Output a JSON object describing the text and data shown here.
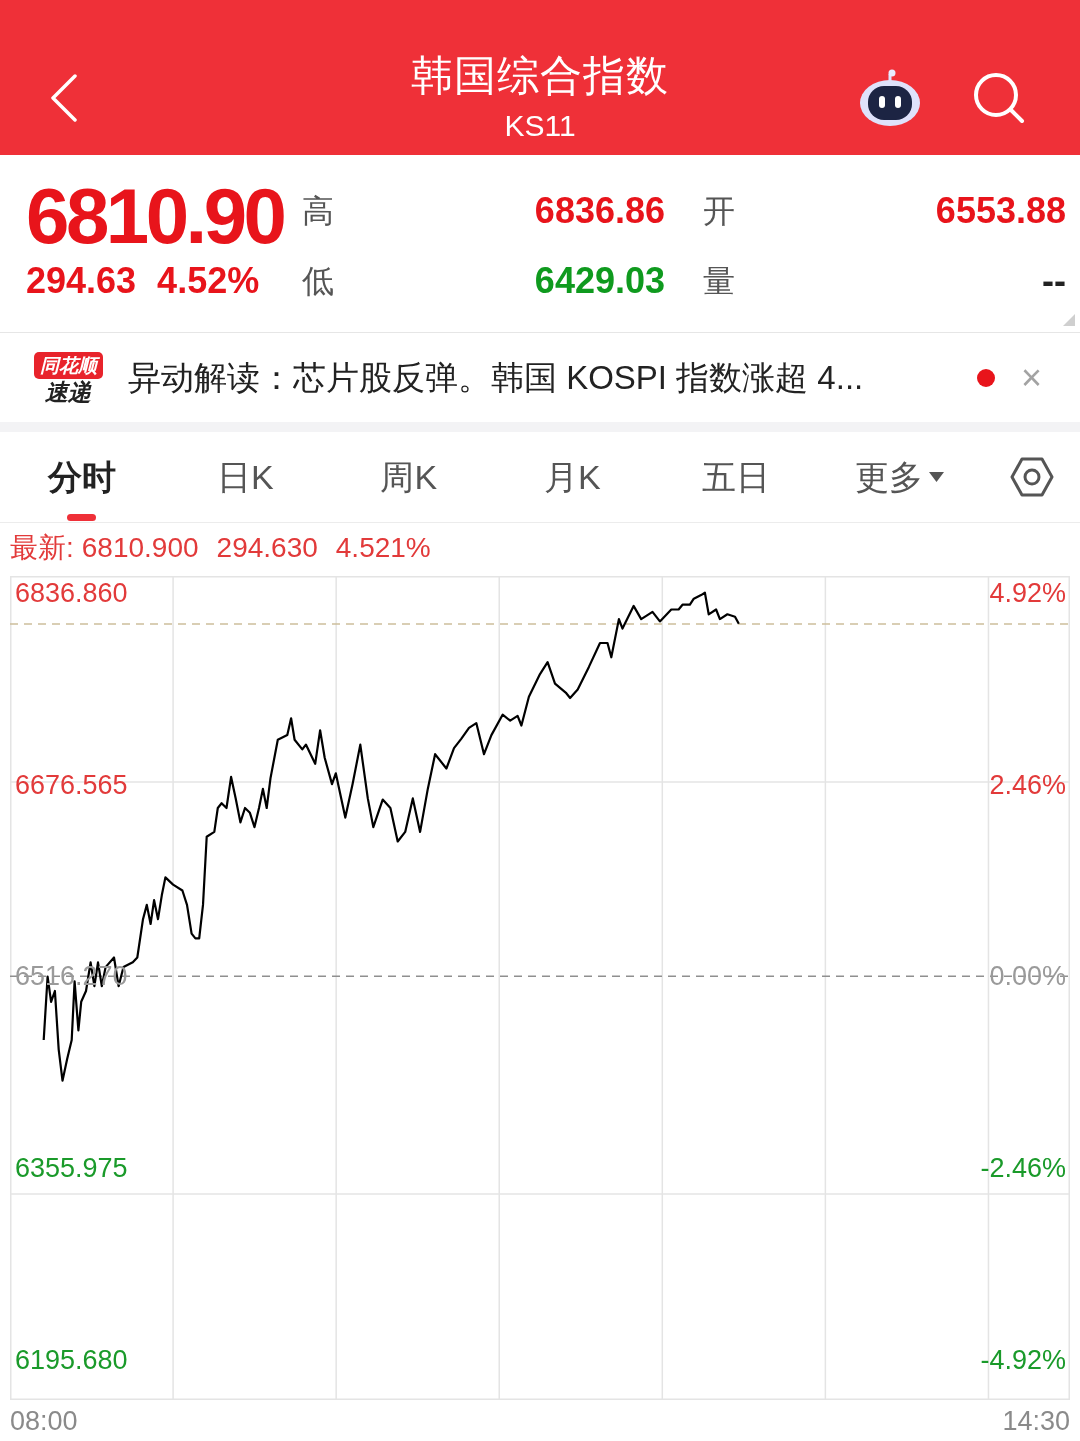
{
  "header": {
    "title": "韩国综合指数",
    "code": "KS11"
  },
  "quote": {
    "price": "6810.90",
    "change": "294.63",
    "change_pct": "4.52%",
    "rising": true,
    "stats": [
      {
        "label": "高",
        "value": "6836.86",
        "color": "#e8141b"
      },
      {
        "label": "开",
        "value": "6553.88",
        "color": "#e8141b"
      },
      {
        "label": "低",
        "value": "6429.03",
        "color": "#0f9a1e"
      },
      {
        "label": "量",
        "value": "--",
        "color": "#222222"
      }
    ]
  },
  "news": {
    "logo_top": "同花顺",
    "logo_bottom": "速递",
    "headline": "异动解读：芯片股反弹。韩国 KOSPI 指数涨超 4...",
    "unread": true,
    "close": "×"
  },
  "tabs": [
    {
      "label": "分时",
      "selected": true,
      "kind": "plain"
    },
    {
      "label": "日K",
      "selected": false,
      "kind": "plain"
    },
    {
      "label": "周K",
      "selected": false,
      "kind": "plain"
    },
    {
      "label": "月K",
      "selected": false,
      "kind": "plain"
    },
    {
      "label": "五日",
      "selected": false,
      "kind": "plain"
    },
    {
      "label": "更多",
      "selected": false,
      "kind": "dropdown"
    }
  ],
  "chart": {
    "latest": {
      "label": "最新:",
      "price": "6810.900",
      "change": "294.630",
      "change_pct": "4.521%",
      "rising": true
    },
    "pct_labels": [
      {
        "text": "4.92%",
        "color": "#e23a3a"
      },
      {
        "text": "2.46%",
        "color": "#e23a3a"
      },
      {
        "text": "0.00%",
        "color": "#9a9a9a"
      },
      {
        "text": "-2.46%",
        "color": "#1a9a2a"
      },
      {
        "text": "-4.92%",
        "color": "#1a9a2a"
      }
    ],
    "chart_data": {
      "type": "line",
      "x": [
        8.0,
        8.025,
        8.048,
        8.073,
        8.098,
        8.123,
        8.153,
        8.183,
        8.202,
        8.227,
        8.245,
        8.277,
        8.307,
        8.332,
        8.355,
        8.38,
        8.405,
        8.46,
        8.49,
        8.522,
        8.583,
        8.613,
        8.65,
        8.675,
        8.7,
        8.723,
        8.748,
        8.773,
        8.797,
        8.847,
        8.908,
        8.938,
        8.968,
        8.993,
        9.018,
        9.043,
        9.067,
        9.117,
        9.14,
        9.165,
        9.197,
        9.227,
        9.257,
        9.288,
        9.318,
        9.35,
        9.38,
        9.41,
        9.435,
        9.46,
        9.485,
        9.533,
        9.595,
        9.62,
        9.643,
        9.693,
        9.717,
        9.778,
        9.81,
        9.84,
        9.888,
        9.913,
        9.975,
        10.023,
        10.073,
        10.122,
        10.158,
        10.22,
        10.27,
        10.318,
        10.367,
        10.417,
        10.465,
        10.515,
        10.563,
        10.637,
        10.687,
        10.735,
        10.785,
        10.833,
        10.883,
        10.932,
        11.005,
        11.055,
        11.103,
        11.128,
        11.177,
        11.25,
        11.3,
        11.348,
        11.422,
        11.447,
        11.497,
        11.57,
        11.643,
        11.692,
        11.717,
        11.767,
        11.79,
        11.863,
        11.913,
        11.987,
        12.035,
        12.11,
        12.158,
        12.183,
        12.232,
        12.257,
        12.305,
        12.33,
        12.355,
        12.403,
        12.428,
        12.477,
        12.527,
        12.552
      ],
      "series": [
        {
          "color": "#000000",
          "values": [
            6463,
            6516,
            6495,
            6504,
            6455,
            6429,
            6447,
            6463,
            6512,
            6471,
            6495,
            6504,
            6528,
            6508,
            6528,
            6508,
            6524,
            6532,
            6508,
            6524,
            6528,
            6532,
            6564,
            6576,
            6560,
            6580,
            6564,
            6584,
            6599,
            6593,
            6588,
            6576,
            6552,
            6548,
            6548,
            6576,
            6633,
            6637,
            6657,
            6661,
            6657,
            6683,
            6665,
            6645,
            6657,
            6653,
            6641,
            6657,
            6673,
            6657,
            6682,
            6714,
            6718,
            6732,
            6714,
            6706,
            6710,
            6694,
            6722,
            6699,
            6677,
            6686,
            6649,
            6677,
            6710,
            6665,
            6641,
            6664,
            6657,
            6629,
            6637,
            6665,
            6637,
            6673,
            6702,
            6690,
            6707,
            6715,
            6724,
            6728,
            6702,
            6718,
            6735,
            6730,
            6734,
            6726,
            6750,
            6769,
            6779,
            6761,
            6753,
            6749,
            6756,
            6775,
            6795,
            6795,
            6783,
            6815,
            6807,
            6826,
            6815,
            6821,
            6813,
            6823,
            6823,
            6827,
            6827,
            6832,
            6835,
            6837,
            6819,
            6823,
            6815,
            6819,
            6817,
            6811
          ]
        }
      ],
      "xlim": [
        7.779,
        14.721
      ],
      "ylim": [
        6162,
        6851
      ],
      "xticks": [
        {
          "value": 8,
          "label": "08:00"
        },
        {
          "value": 14.5,
          "label": "14:30"
        }
      ],
      "yticks": [
        {
          "value": 6836.86,
          "label": "6836.860"
        },
        {
          "value": 6676.565,
          "label": "6676.565"
        },
        {
          "value": 6516.27,
          "label": "6516.270"
        },
        {
          "value": 6355.975,
          "label": "6355.975"
        },
        {
          "value": 6195.68,
          "label": "6195.680"
        }
      ],
      "grid": true,
      "ref_lines": [
        {
          "axis": "y",
          "value": 6810.9,
          "color": "#cdbf9c"
        },
        {
          "axis": "y",
          "value": 6516.27,
          "color": "#8f8f8f"
        }
      ]
    }
  }
}
